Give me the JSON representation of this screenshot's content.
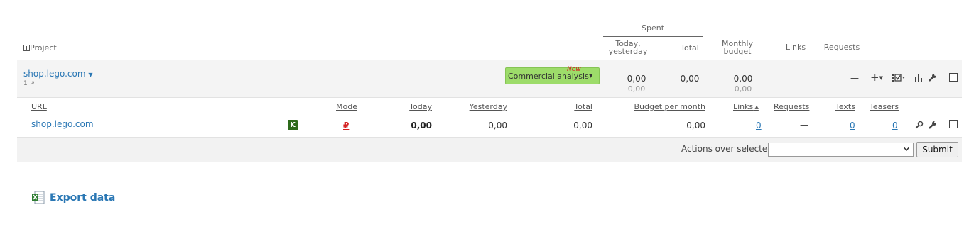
{
  "header": {
    "spent_label": "Spent",
    "project_label": "Project",
    "today_yesterday_l1": "Today,",
    "today_yesterday_l2": "yesterday",
    "total_label": "Total",
    "monthly_l1": "Monthly",
    "monthly_l2": "budget",
    "links_label": "Links",
    "requests_label": "Requests"
  },
  "project": {
    "name": "shop.lego.com",
    "count": "1",
    "commercial_label": "Commercial analysis",
    "new_badge": "New",
    "today_val": "0,00",
    "yesterday_val": "0,00",
    "total_val": "0,00",
    "monthly_val": "0,00",
    "monthly_sub": "0,00",
    "dash": "—"
  },
  "columns": {
    "url": "URL",
    "mode": "Mode",
    "today": "Today",
    "yesterday": "Yesterday",
    "total": "Total",
    "budget": "Budget per month",
    "links": "Links",
    "requests": "Requests",
    "texts": "Texts",
    "teasers": "Teasers"
  },
  "site": {
    "url": "shop.lego.com",
    "k_badge": "K",
    "mode_symbol": "₽",
    "today": "0,00",
    "yesterday": "0,00",
    "total": "0,00",
    "budget": "0,00",
    "links": "0",
    "requests": "—",
    "texts": "0",
    "teasers": "0"
  },
  "actions": {
    "label": "Actions over selected:",
    "select_value": "",
    "submit_label": "Submit"
  },
  "export": {
    "label": "Export data"
  },
  "colors": {
    "link": "#2a77b4",
    "green_button": "#9ddc6a",
    "new_badge": "#d42020",
    "k_badge": "#2d6a1b"
  }
}
